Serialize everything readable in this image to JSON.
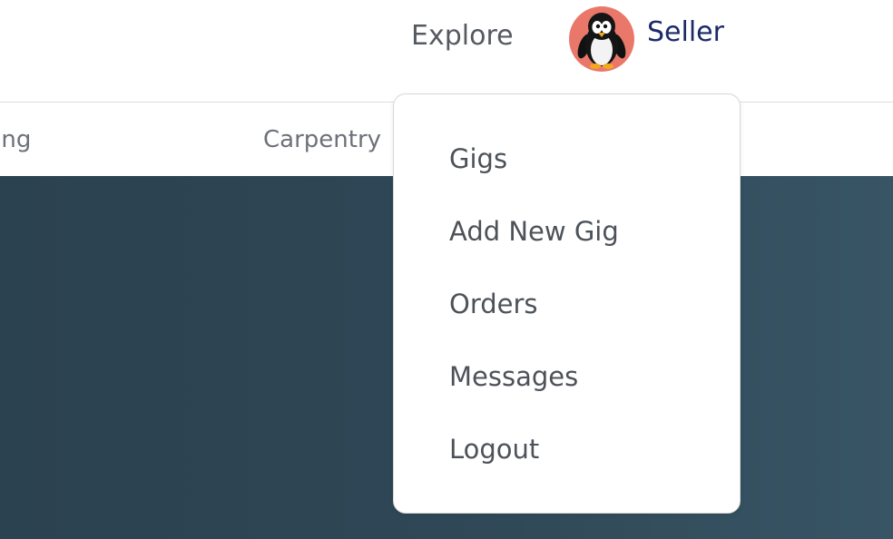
{
  "navbar": {
    "explore_label": "Explore",
    "seller_label": "Seller",
    "avatar_icon": "penguin-avatar-icon",
    "avatar_bg": "#e9786b"
  },
  "categories": [
    {
      "label": "ting"
    },
    {
      "label": "Carpentry"
    }
  ],
  "dropdown": {
    "items": [
      {
        "label": "Gigs"
      },
      {
        "label": "Add New Gig"
      },
      {
        "label": "Orders"
      },
      {
        "label": "Messages"
      },
      {
        "label": "Logout"
      }
    ]
  },
  "colors": {
    "seller_text": "#1c2a66",
    "hero_bg": "#2f4756"
  }
}
